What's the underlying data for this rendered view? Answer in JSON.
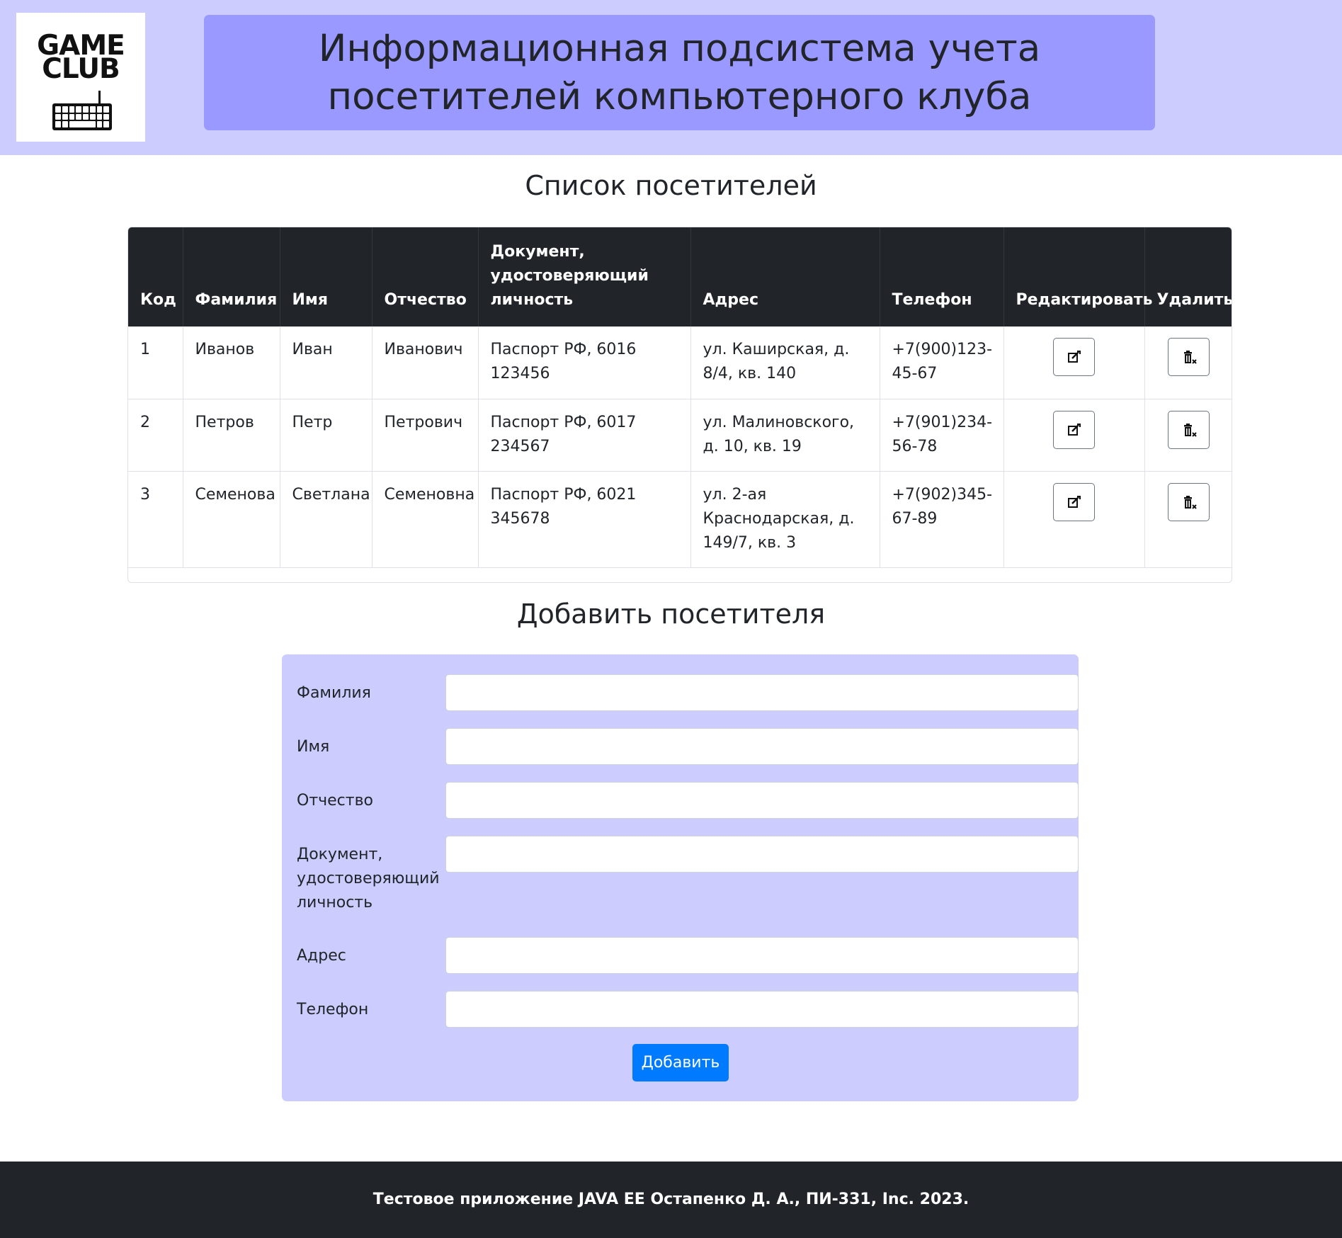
{
  "header": {
    "logo": {
      "line1": "GAME",
      "line2": "CLUB"
    },
    "title": "Информационная подсистема учета посетителей компьютерного клуба"
  },
  "visitors": {
    "title": "Список посетителей",
    "columns": [
      "Код",
      "Фамилия",
      "Имя",
      "Отчество",
      "Документ, удостоверяющий личность",
      "Адрес",
      "Телефон",
      "Редактировать",
      "Удалить"
    ],
    "rows": [
      {
        "code": "1",
        "surname": "Иванов",
        "name": "Иван",
        "patronymic": "Иванович",
        "document": "Паспорт РФ, 6016 123456",
        "address": "ул. Каширская, д. 8/4, кв. 140",
        "phone": "+7(900)123-45-67"
      },
      {
        "code": "2",
        "surname": "Петров",
        "name": "Петр",
        "patronymic": "Петрович",
        "document": "Паспорт РФ, 6017 234567",
        "address": "ул. Малиновского, д. 10, кв. 19",
        "phone": "+7(901)234-56-78"
      },
      {
        "code": "3",
        "surname": "Семенова",
        "name": "Светлана",
        "patronymic": "Семеновна",
        "document": "Паспорт РФ, 6021 345678",
        "address": "ул. 2-ая Краснодарская, д. 149/7, кв. 3",
        "phone": "+7(902)345-67-89"
      }
    ],
    "edit_icon": "edit-icon",
    "delete_icon": "trash-icon"
  },
  "form": {
    "title": "Добавить посетителя",
    "fields": {
      "surname": {
        "label": "Фамилия",
        "value": ""
      },
      "name": {
        "label": "Имя",
        "value": ""
      },
      "patronymic": {
        "label": "Отчество",
        "value": ""
      },
      "document": {
        "label": "Документ, удостоверяющий личность",
        "value": ""
      },
      "address": {
        "label": "Адрес",
        "value": ""
      },
      "phone": {
        "label": "Телефон",
        "value": ""
      }
    },
    "submit_label": "Добавить"
  },
  "footer": {
    "text": "Тестовое приложение JAVA EE Остапенко Д. А., ПИ-331, Inc. 2023."
  },
  "colors": {
    "header_bg": "#ccccff",
    "title_bg": "#9999ff",
    "table_head_bg": "#212529",
    "form_bg": "#ccccff",
    "primary_button": "#007bff",
    "footer_bg": "#212529"
  }
}
